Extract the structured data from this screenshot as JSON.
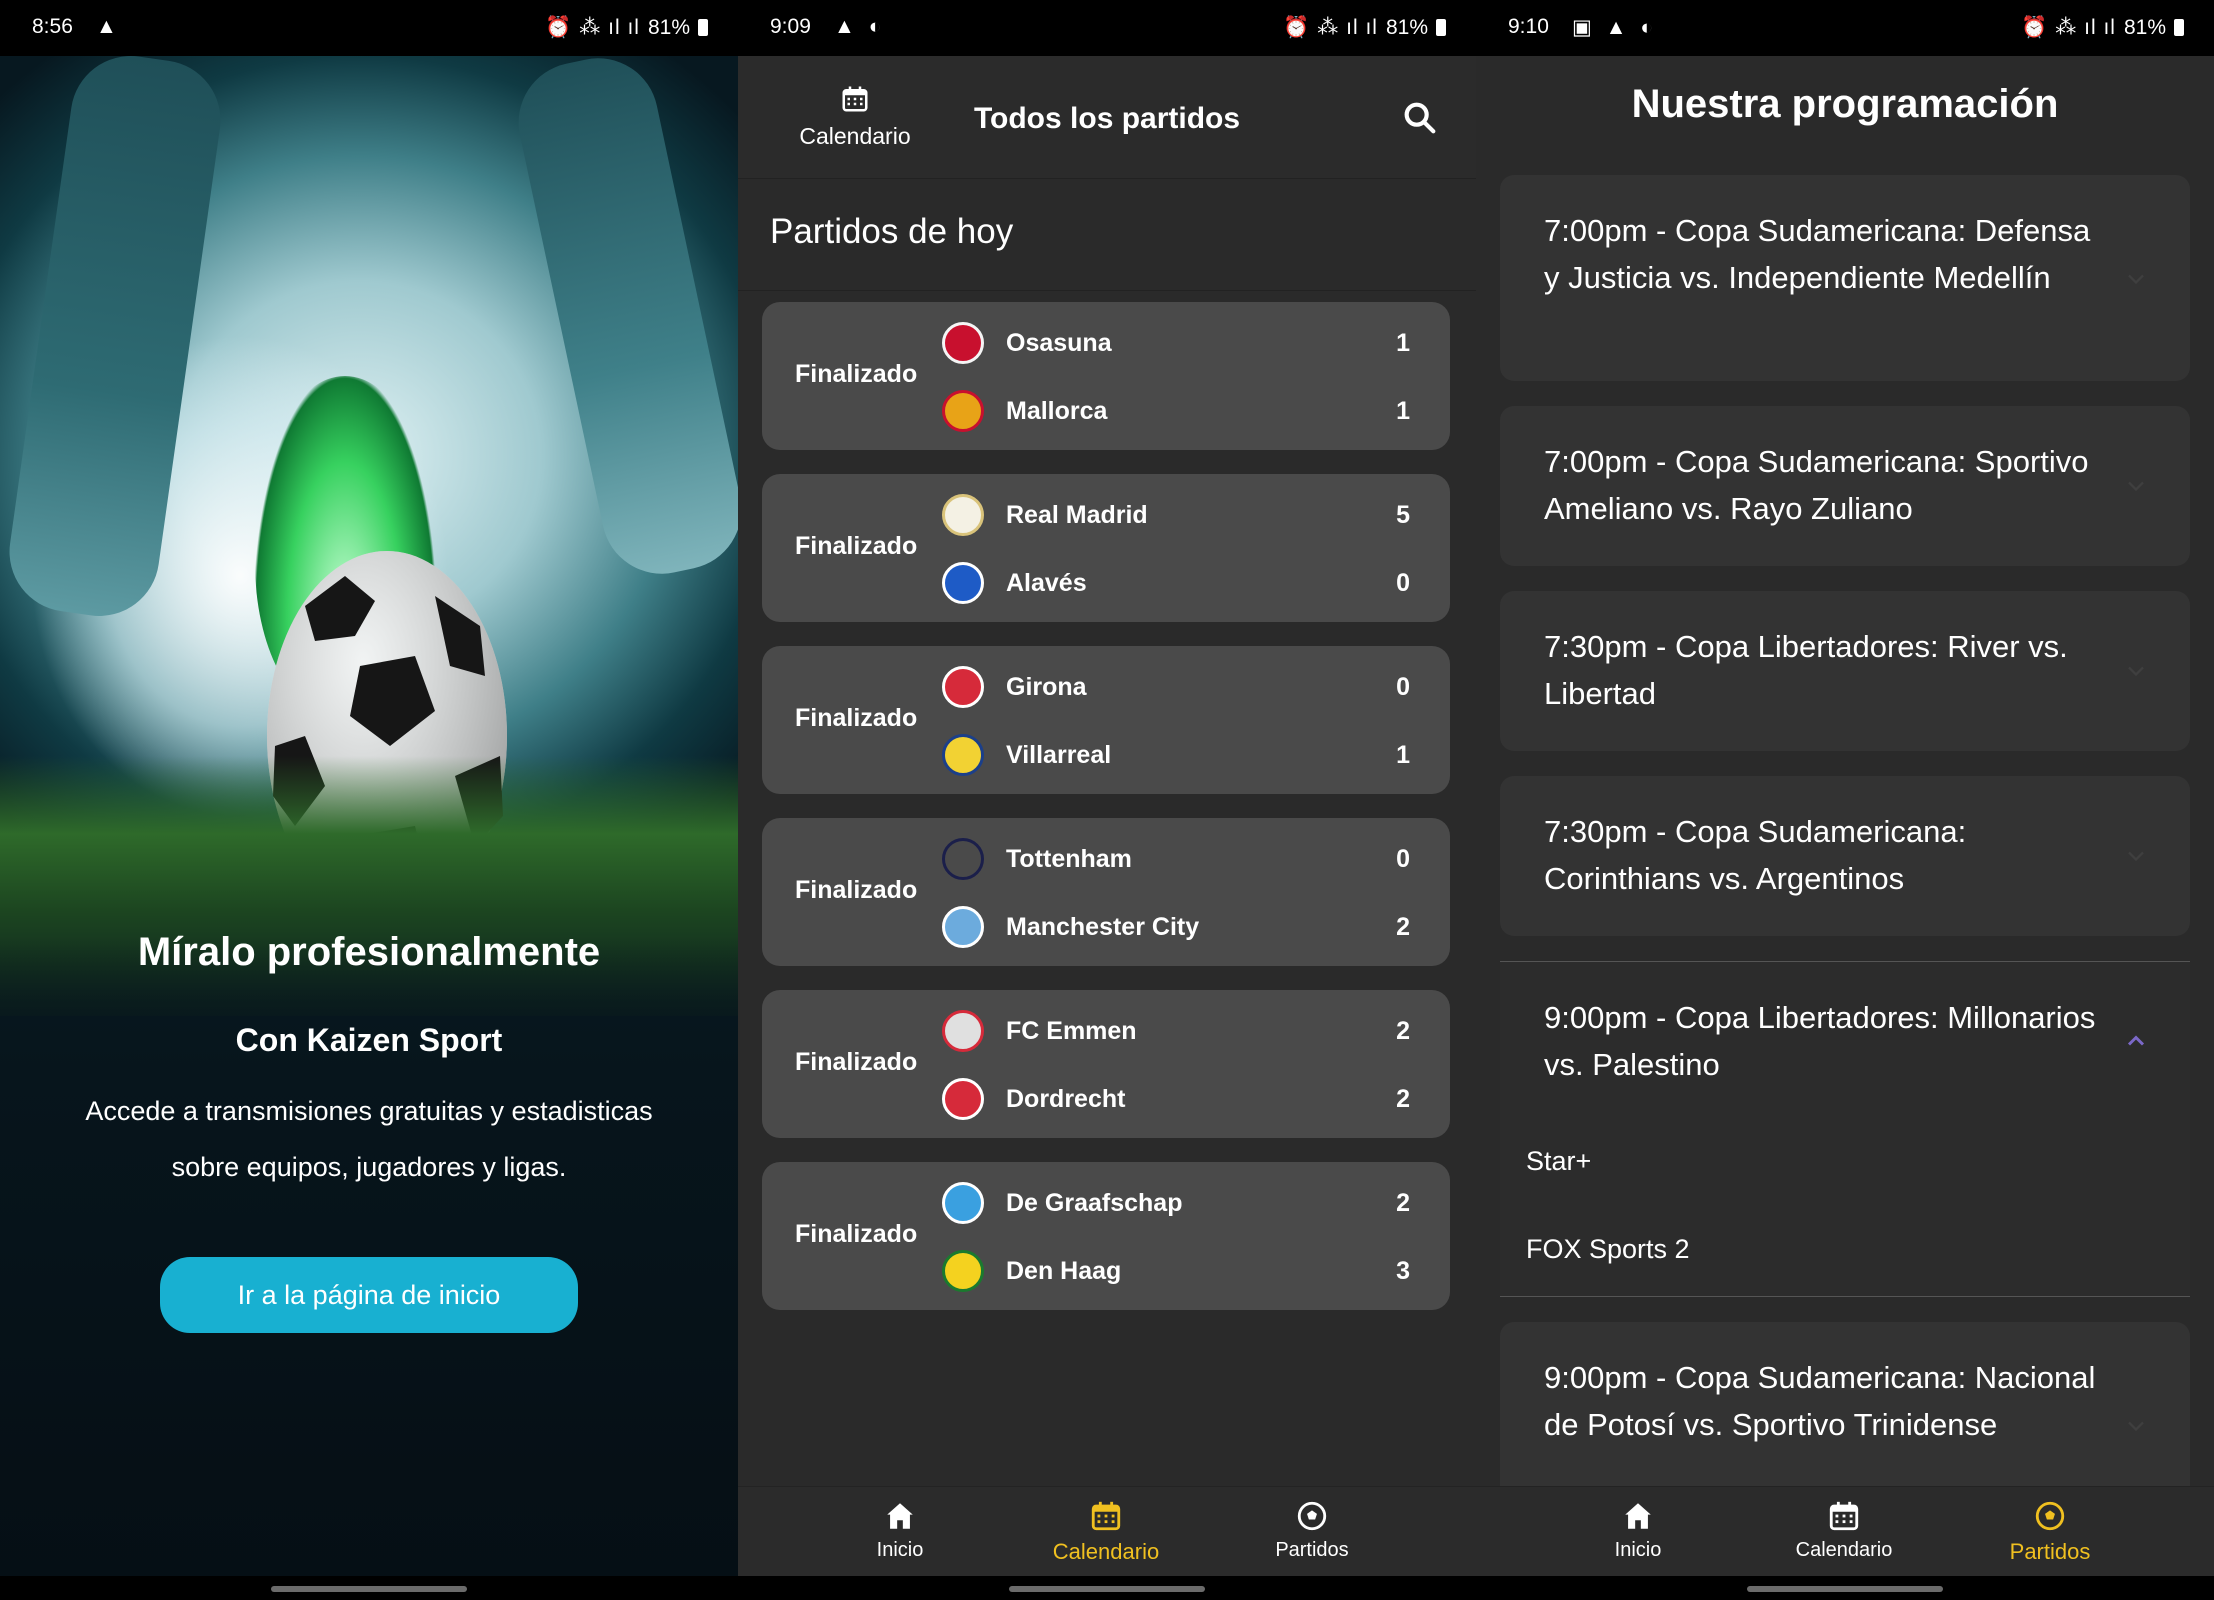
{
  "screen1": {
    "status": {
      "time": "8:56",
      "battery": "81%"
    },
    "title": "Míralo profesionalmente",
    "subtitle": "Con Kaizen Sport",
    "description": "Accede a transmisiones gratuitas y estadisticas sobre equipos, jugadores y ligas.",
    "button": "Ir a la página de inicio"
  },
  "screen2": {
    "status": {
      "time": "9:09",
      "battery": "81%"
    },
    "calendar_label": "Calendario",
    "title": "Todos los partidos",
    "section": "Partidos de hoy",
    "matches": [
      {
        "status": "Finalizado",
        "home": "Osasuna",
        "home_score": "1",
        "away": "Mallorca",
        "away_score": "1",
        "home_color": "#c8102e",
        "away_color": "#e8a317"
      },
      {
        "status": "Finalizado",
        "home": "Real Madrid",
        "home_score": "5",
        "away": "Alavés",
        "away_score": "0",
        "home_color": "#d9c37a",
        "away_color": "#1e5bc6"
      },
      {
        "status": "Finalizado",
        "home": "Girona",
        "home_score": "0",
        "away": "Villarreal",
        "away_score": "1",
        "home_color": "#d62a3a",
        "away_color": "#f2d233"
      },
      {
        "status": "Finalizado",
        "home": "Tottenham",
        "home_score": "0",
        "away": "Manchester City",
        "away_score": "2",
        "home_color": "#1b1f4a",
        "away_color": "#6cabdd"
      },
      {
        "status": "Finalizado",
        "home": "FC Emmen",
        "home_score": "2",
        "away": "Dordrecht",
        "away_score": "2",
        "home_color": "#e0e0e0",
        "away_color": "#d62a3a"
      },
      {
        "status": "Finalizado",
        "home": "De Graafschap",
        "home_score": "2",
        "away": "Den Haag",
        "away_score": "3",
        "home_color": "#3aa0e0",
        "away_color": "#f4d21f"
      }
    ],
    "nav": [
      "Inicio",
      "Calendario",
      "Partidos"
    ],
    "nav_active": "Calendario"
  },
  "screen3": {
    "status": {
      "time": "9:10",
      "battery": "81%"
    },
    "title": "Nuestra programación",
    "items": [
      {
        "text": "7:00pm - Copa Sudamericana: Defensa y Justicia vs. Independiente Medellín"
      },
      {
        "text": "7:00pm - Copa Sudamericana: Sportivo Ameliano vs. Rayo Zuliano"
      },
      {
        "text": "7:30pm - Copa Libertadores: River vs. Libertad"
      },
      {
        "text": "7:30pm - Copa Sudamericana: Corinthians vs. Argentinos"
      },
      {
        "text": "9:00pm - Copa Libertadores: Millonarios vs. Palestino",
        "expanded": true,
        "channels": [
          "Star+",
          "FOX Sports 2"
        ]
      },
      {
        "text": "9:00pm - Copa Sudamericana: Nacional de Potosí vs. Sportivo Trinidense"
      }
    ],
    "nav": [
      "Inicio",
      "Calendario",
      "Partidos"
    ],
    "nav_active": "Partidos"
  },
  "colors": {
    "accent": "#18b0d1",
    "nav_active": "#f0c020",
    "card": "#4a4a4a",
    "bg": "#2a2a2a"
  }
}
